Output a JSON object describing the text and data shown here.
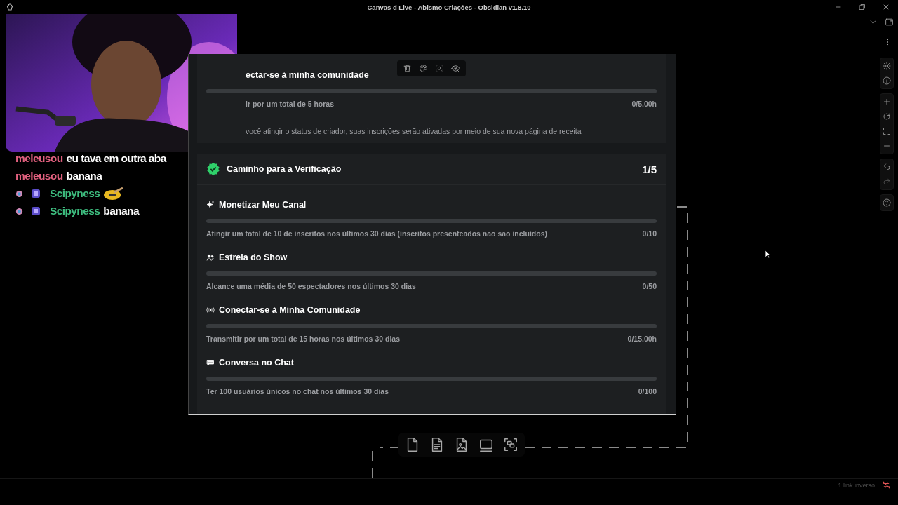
{
  "window": {
    "title": "Canvas d Live - Abismo Criações - Obsidian v1.8.10"
  },
  "chat": {
    "messages": [
      {
        "user": "meleusou",
        "color": "#e0607e",
        "text": "eu tava em outra aba",
        "badges": false,
        "emote": false
      },
      {
        "user": "meleusou",
        "color": "#e0607e",
        "text": "banana",
        "badges": false,
        "emote": false
      },
      {
        "user": "Scipyness",
        "color": "#3ebd7f",
        "badges": true,
        "emote": true
      },
      {
        "user": "Scipyness",
        "color": "#3ebd7f",
        "text": "banana",
        "badges": true,
        "emote": false
      }
    ]
  },
  "card": {
    "partial_section": {
      "title": "ectar-se à minha comunidade",
      "goal": {
        "description": "ir por um total de 5 horas",
        "reading": "0/5.00h",
        "level": 0
      },
      "note": "você atingir o status de criador, suas inscrições serão ativadas por meio de sua nova página de receita"
    },
    "path": {
      "title": "Caminho para a Verificação",
      "count": "1/5",
      "verified": true,
      "goals": [
        {
          "kind": "sparkle",
          "title": "Monetizar Meu Canal",
          "description": "Atingir um total de 10 de inscritos nos últimos 30 dias (inscritos presenteados não são incluídos)",
          "reading": "0/10",
          "level": 0
        },
        {
          "kind": "people",
          "title": "Estrela do Show",
          "description": "Alcance uma média de 50 espectadores nos últimos 30 dias",
          "reading": "0/50",
          "level": 0
        },
        {
          "kind": "broadcast",
          "title": "Conectar-se à Minha Comunidade",
          "description": "Transmitir por um total de 15 horas nos últimos 30 dias",
          "reading": "0/15.00h",
          "level": 0
        },
        {
          "kind": "chat",
          "title": "Conversa no Chat",
          "description": "Ter 100 usuários únicos no chat nos últimos 30 dias",
          "reading": "0/100",
          "level": 0
        }
      ]
    }
  },
  "status_bar": {
    "backlinks": "1 link inverso"
  }
}
